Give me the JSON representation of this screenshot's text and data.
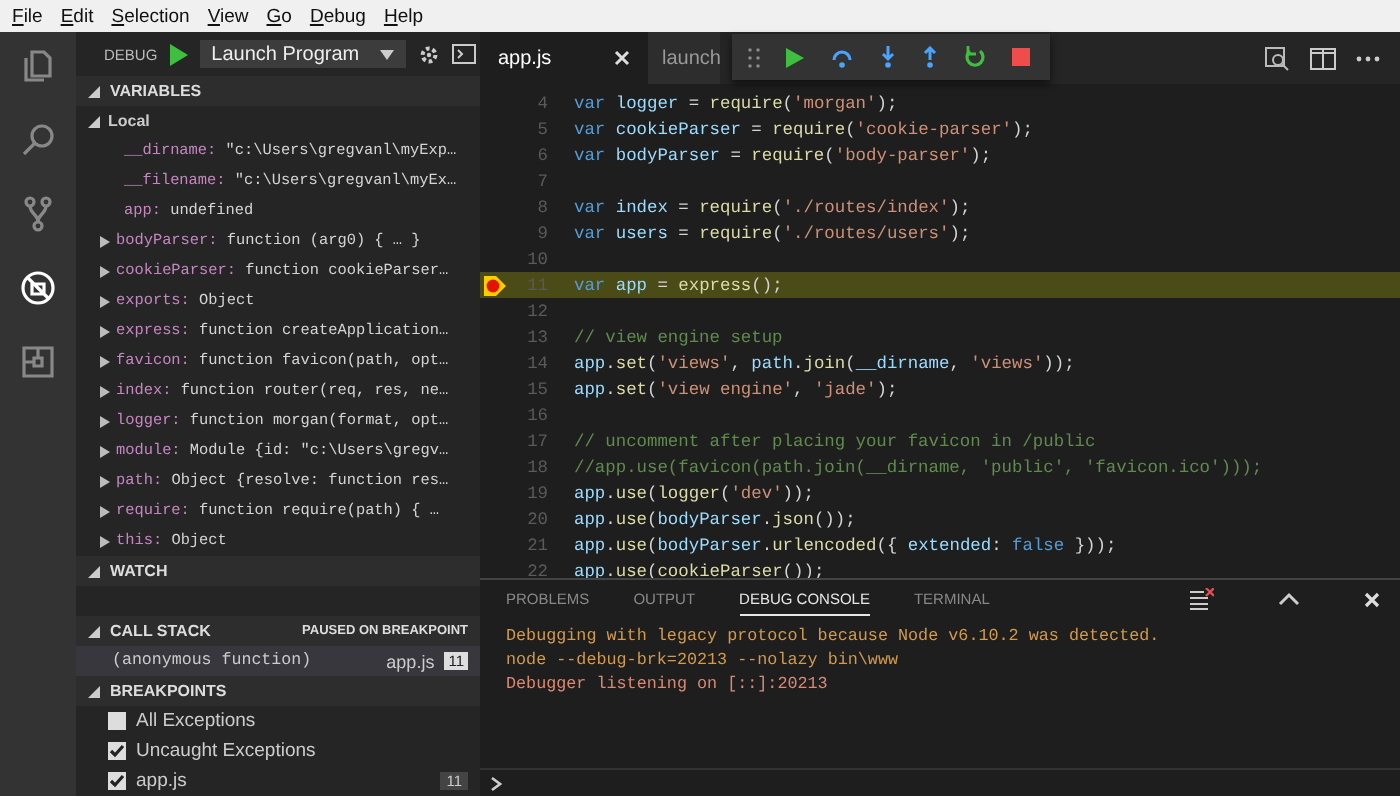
{
  "menu": [
    "File",
    "Edit",
    "Selection",
    "View",
    "Go",
    "Debug",
    "Help"
  ],
  "activity_bar": [
    {
      "kind": "files",
      "selected": false
    },
    {
      "kind": "search",
      "selected": false
    },
    {
      "kind": "source-control",
      "selected": false
    },
    {
      "kind": "debug",
      "selected": true
    },
    {
      "kind": "extensions",
      "selected": false
    }
  ],
  "debug_toolbar": {
    "label": "DEBUG",
    "configuration": "Launch Program"
  },
  "variables": {
    "title": "VARIABLES",
    "expanded": true,
    "scopes": [
      {
        "name": "Local",
        "expanded": true,
        "children": [
          {
            "name": "__dirname:",
            "value": "\"c:\\Users\\gregvanl\\myExp…",
            "expandable": false
          },
          {
            "name": "__filename:",
            "value": "\"c:\\Users\\gregvanl\\myEx…",
            "expandable": false
          },
          {
            "name": "app:",
            "value": "undefined",
            "expandable": false
          },
          {
            "name": "bodyParser:",
            "value": "function (arg0) { … }",
            "expandable": true
          },
          {
            "name": "cookieParser:",
            "value": "function cookieParser…",
            "expandable": true
          },
          {
            "name": "exports:",
            "value": "Object",
            "expandable": true
          },
          {
            "name": "express:",
            "value": "function createApplication…",
            "expandable": true
          },
          {
            "name": "favicon:",
            "value": "function favicon(path, opt…",
            "expandable": true
          },
          {
            "name": "index:",
            "value": "function router(req, res, ne…",
            "expandable": true
          },
          {
            "name": "logger:",
            "value": "function morgan(format, opt…",
            "expandable": true
          },
          {
            "name": "module:",
            "value": "Module {id: \"c:\\Users\\gregv…",
            "expandable": true
          },
          {
            "name": "path:",
            "value": "Object {resolve: function res…",
            "expandable": true
          },
          {
            "name": "require:",
            "value": "function require(path) { …",
            "expandable": true
          },
          {
            "name": "this:",
            "value": "Object",
            "expandable": true
          }
        ]
      }
    ]
  },
  "watch": {
    "title": "WATCH",
    "expanded": true
  },
  "call_stack": {
    "title": "CALL STACK",
    "expanded": true,
    "status": "PAUSED ON BREAKPOINT",
    "frames": [
      {
        "name": "(anonymous function)",
        "file": "app.js",
        "line": "11",
        "selected": true
      }
    ]
  },
  "breakpoints": {
    "title": "BREAKPOINTS",
    "expanded": true,
    "items": [
      {
        "label": "All Exceptions",
        "checked": false
      },
      {
        "label": "Uncaught Exceptions",
        "checked": true
      },
      {
        "label": "app.js",
        "checked": true,
        "line": "11"
      }
    ]
  },
  "editor": {
    "tabs": [
      {
        "label": "app.js",
        "selected": true,
        "closable": true
      },
      {
        "label": "launch",
        "selected": false,
        "closable": false
      }
    ],
    "lines": [
      {
        "number": "4",
        "text": "var logger = require('morgan');",
        "current": false,
        "breakpoint": false
      },
      {
        "number": "5",
        "text": "var cookieParser = require('cookie-parser');",
        "current": false,
        "breakpoint": false
      },
      {
        "number": "6",
        "text": "var bodyParser = require('body-parser');",
        "current": false,
        "breakpoint": false
      },
      {
        "number": "7",
        "current": false,
        "breakpoint": false
      },
      {
        "number": "8",
        "text": "var index = require('./routes/index');",
        "current": false,
        "breakpoint": false
      },
      {
        "number": "9",
        "text": "var users = require('./routes/users');",
        "current": false,
        "breakpoint": false
      },
      {
        "number": "10",
        "current": false,
        "breakpoint": false
      },
      {
        "number": "11",
        "text": "var app = express();",
        "current": true,
        "breakpoint": true
      },
      {
        "number": "12",
        "current": false,
        "breakpoint": false
      },
      {
        "number": "13",
        "text": "// view engine setup",
        "current": false,
        "breakpoint": false
      },
      {
        "number": "14",
        "text": "app.set('views', path.join(__dirname, 'views'));",
        "current": false,
        "breakpoint": false
      },
      {
        "number": "15",
        "text": "app.set('view engine', 'jade');",
        "current": false,
        "breakpoint": false
      },
      {
        "number": "16",
        "current": false,
        "breakpoint": false
      },
      {
        "number": "17",
        "text": "// uncomment after placing your favicon in /public",
        "current": false,
        "breakpoint": false
      },
      {
        "number": "18",
        "text": "//app.use(favicon(path.join(__dirname, 'public', 'favicon.ico')));",
        "current": false,
        "breakpoint": false
      },
      {
        "number": "19",
        "text": "app.use(logger('dev'));",
        "current": false,
        "breakpoint": false
      },
      {
        "number": "20",
        "text": "app.use(bodyParser.json());",
        "current": false,
        "breakpoint": false
      },
      {
        "number": "21",
        "text": "app.use(bodyParser.urlencoded({ extended: false }));",
        "current": false,
        "breakpoint": false
      },
      {
        "number": "22",
        "text": "app.use(cookieParser());",
        "current": false,
        "breakpoint": false
      }
    ]
  },
  "panel": {
    "tabs": [
      {
        "label": "PROBLEMS",
        "selected": false
      },
      {
        "label": "OUTPUT",
        "selected": false
      },
      {
        "label": "DEBUG CONSOLE",
        "selected": true
      },
      {
        "label": "TERMINAL",
        "selected": false
      }
    ],
    "console": [
      {
        "text": "Debugging with legacy protocol because Node v6.10.2 was detected.",
        "color": "#d19a4e"
      },
      {
        "text": "node --debug-brk=20213 --nolazy bin\\www",
        "color": "#d19a4e"
      },
      {
        "text": "Debugger listening on [::]:20213",
        "color": "#d98a74"
      }
    ]
  }
}
